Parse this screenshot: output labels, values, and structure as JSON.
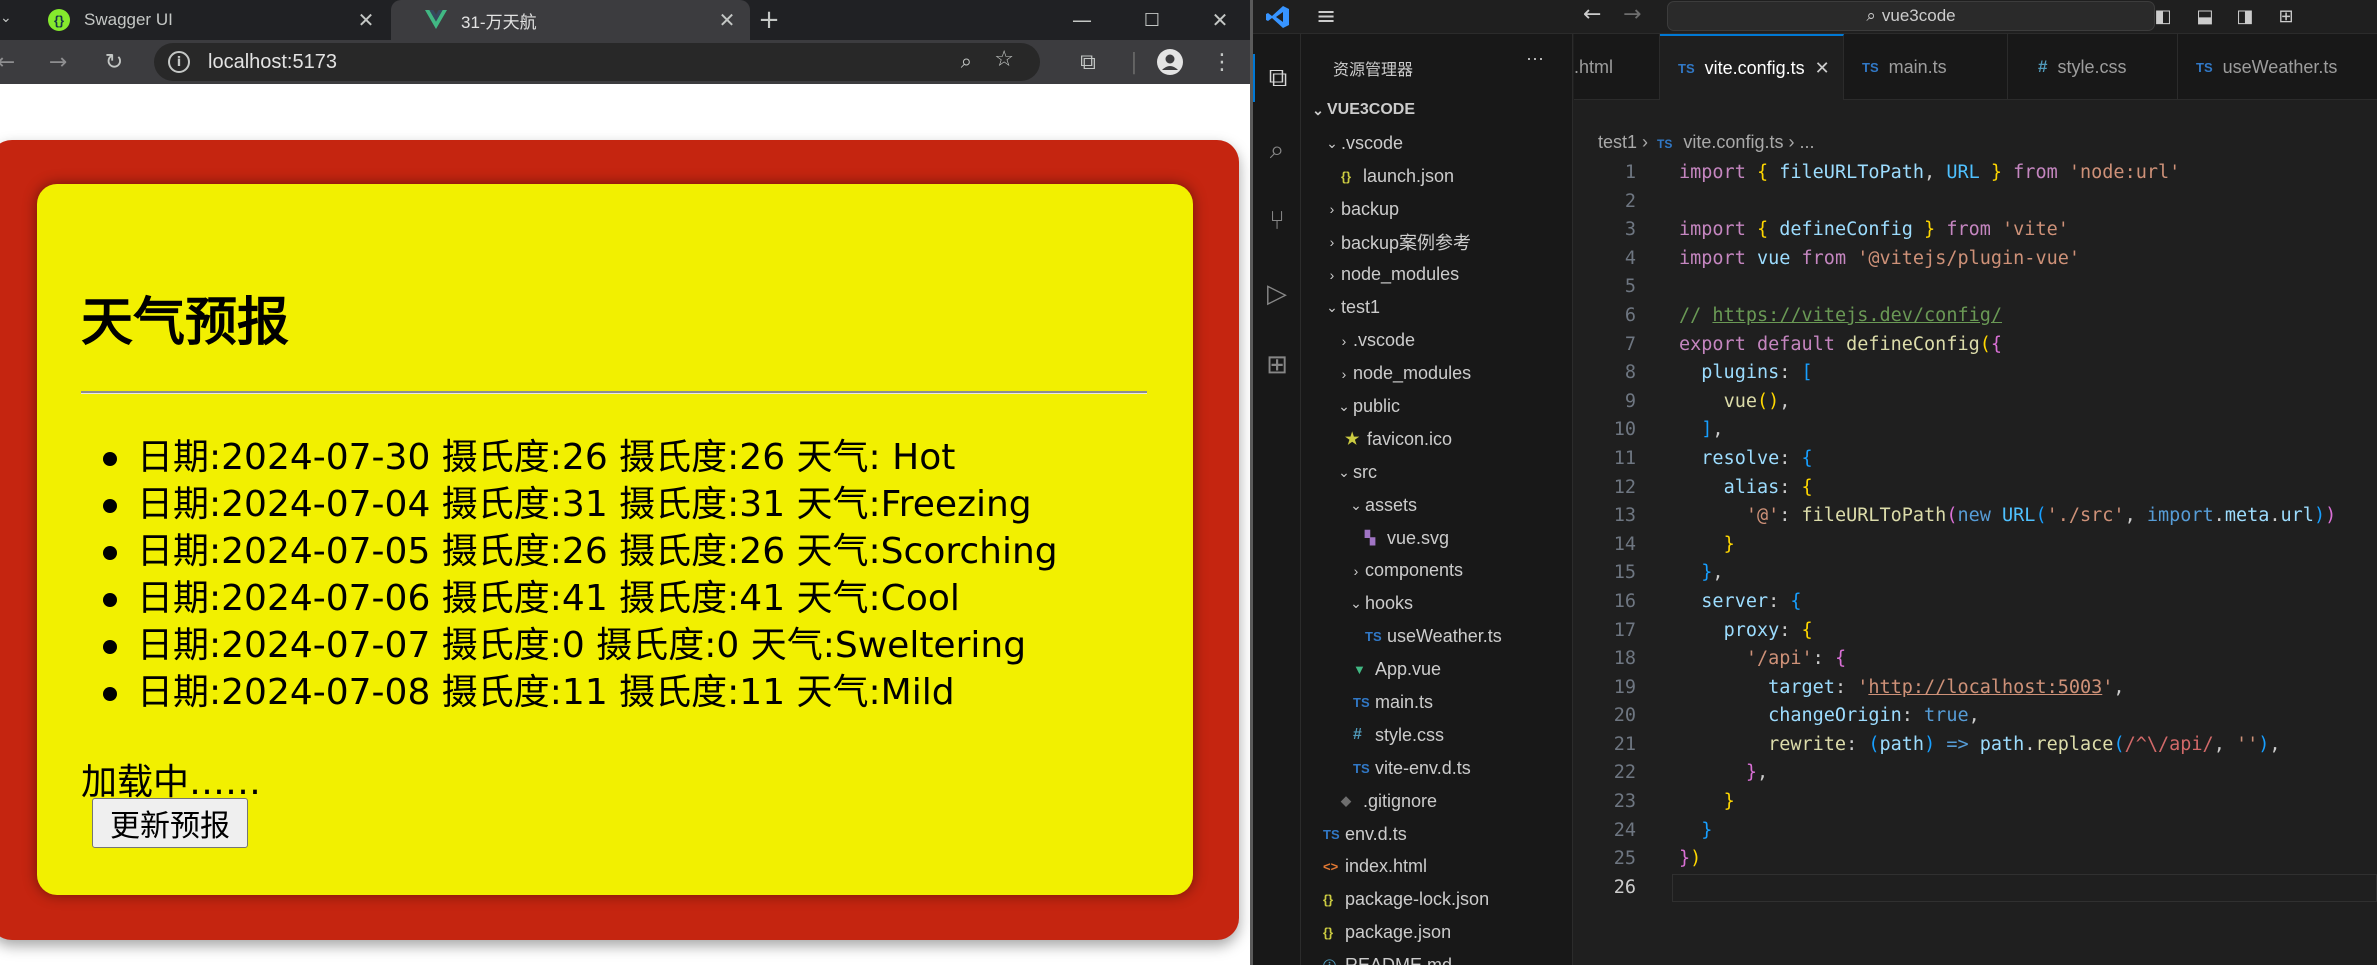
{
  "browser": {
    "tabs": [
      {
        "title": "Swagger UI",
        "favicon": "swagger-icon"
      },
      {
        "title": "31-万天航",
        "favicon": "vue-icon"
      }
    ],
    "url": "localhost:5173",
    "page": {
      "title": "天气预报",
      "forecasts": [
        "日期:2024-07-30 摄氏度:26 摄氏度:26 天气: Hot",
        "日期:2024-07-04 摄氏度:31 摄氏度:31 天气:Freezing",
        "日期:2024-07-05 摄氏度:26 摄氏度:26 天气:Scorching",
        "日期:2024-07-06 摄氏度:41 摄氏度:41 天气:Cool",
        "日期:2024-07-07 摄氏度:0 摄氏度:0 天气:Sweltering",
        "日期:2024-07-08 摄氏度:11 摄氏度:11 天气:Mild"
      ],
      "loading_text": "加载中……",
      "refresh_button": "更新预报"
    },
    "colors": {
      "outer_card": "#c52510",
      "inner_card": "#f2f000"
    }
  },
  "vscode": {
    "search": "vue3code",
    "sidebar": {
      "header": "资源管理器",
      "root": "VUE3CODE",
      "items": [
        {
          "label": ".vscode",
          "type": "folder",
          "open": true
        },
        {
          "label": "launch.json",
          "type": "json"
        },
        {
          "label": "backup",
          "type": "folder",
          "open": false
        },
        {
          "label": "backup案例参考",
          "type": "folder",
          "open": false
        },
        {
          "label": "node_modules",
          "type": "folder",
          "open": false
        },
        {
          "label": "test1",
          "type": "folder",
          "open": true
        },
        {
          "label": ".vscode",
          "type": "folder",
          "open": false
        },
        {
          "label": "node_modules",
          "type": "folder",
          "open": false
        },
        {
          "label": "public",
          "type": "folder",
          "open": true
        },
        {
          "label": "favicon.ico",
          "type": "ico"
        },
        {
          "label": "src",
          "type": "folder",
          "open": true
        },
        {
          "label": "assets",
          "type": "folder",
          "open": true
        },
        {
          "label": "vue.svg",
          "type": "svg"
        },
        {
          "label": "components",
          "type": "folder",
          "open": false
        },
        {
          "label": "hooks",
          "type": "folder",
          "open": true
        },
        {
          "label": "useWeather.ts",
          "type": "ts"
        },
        {
          "label": "App.vue",
          "type": "vue"
        },
        {
          "label": "main.ts",
          "type": "ts"
        },
        {
          "label": "style.css",
          "type": "css"
        },
        {
          "label": "vite-env.d.ts",
          "type": "ts"
        },
        {
          "label": ".gitignore",
          "type": "git"
        },
        {
          "label": "env.d.ts",
          "type": "ts"
        },
        {
          "label": "index.html",
          "type": "html"
        },
        {
          "label": "package-lock.json",
          "type": "json"
        },
        {
          "label": "package.json",
          "type": "json"
        },
        {
          "label": "README.md",
          "type": "md"
        }
      ]
    },
    "editor_tabs": [
      {
        "label": ".html",
        "icon": "html-icon",
        "active": false
      },
      {
        "label": "vite.config.ts",
        "icon": "ts-icon",
        "active": true
      },
      {
        "label": "main.ts",
        "icon": "ts-icon",
        "active": false
      },
      {
        "label": "style.css",
        "icon": "css-icon",
        "active": false
      },
      {
        "label": "useWeather.ts",
        "icon": "ts-icon",
        "active": false
      }
    ],
    "breadcrumb": {
      "folder": "test1",
      "file": "vite.config.ts",
      "tail": "..."
    },
    "code": [
      "import { fileURLToPath, URL } from 'node:url'",
      "",
      "import { defineConfig } from 'vite'",
      "import vue from '@vitejs/plugin-vue'",
      "",
      "// https://vitejs.dev/config/",
      "export default defineConfig({",
      "  plugins: [",
      "    vue(),",
      "  ],",
      "  resolve: {",
      "    alias: {",
      "      '@': fileURLToPath(new URL('./src', import.meta.url))",
      "    }",
      "  },",
      "  server: {",
      "    proxy: {",
      "      '/api': {",
      "        target: 'http://localhost:5003',",
      "        changeOrigin: true,",
      "        rewrite: (path) => path.replace(/^\\/api/, ''),",
      "      },",
      "    }",
      "  }",
      "})",
      ""
    ],
    "current_line": 26
  }
}
